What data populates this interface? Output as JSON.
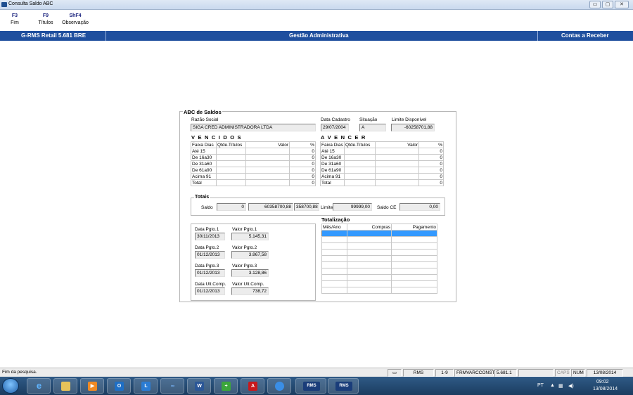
{
  "window": {
    "title": "Consulta Saldo ABC",
    "controls": [
      "▭",
      "▢",
      "✕"
    ]
  },
  "fkeys": [
    {
      "key": "F3",
      "label": "Fim"
    },
    {
      "key": "F9",
      "label": "Títulos"
    },
    {
      "key": "ShF4",
      "label": "Observação"
    }
  ],
  "bar": {
    "left": "G-RMS Retail 5.681 BRE",
    "center": "Gestão Administrativa",
    "right": "Contas a Receber"
  },
  "abc": {
    "title": "ABC de Saldos",
    "razao_label": "Razão Social",
    "razao": "SIGA CRED ADMINISTRADORA LTDA",
    "data_cad_label": "Data Cadastro",
    "data_cad": "29/07/2004",
    "situacao_label": "Situação",
    "situacao": "A",
    "limite_disp_label": "Limite Disponível",
    "limite_disp": "-60258701,88",
    "vencidos_title": "V E N C I D O S",
    "avencer_title": "A  V E N C E R",
    "cols": [
      "Faixa Dias",
      "Qtde.Títulos",
      "Valor",
      "%"
    ],
    "rows": [
      {
        "faixa": "Até 15",
        "pct": "0"
      },
      {
        "faixa": "De 16a30",
        "pct": "0"
      },
      {
        "faixa": "De 31a60",
        "pct": "0"
      },
      {
        "faixa": "De 61a90",
        "pct": "0"
      },
      {
        "faixa": "Acima 91",
        "pct": "0"
      },
      {
        "faixa": "Total",
        "pct": "0"
      }
    ],
    "totais": {
      "title": "Totais",
      "saldo_label": "Saldo",
      "saldo1": "0",
      "saldo2": "60358700,88",
      "saldo3": "358700,88",
      "limite_label": "Limite",
      "limite": "99999,00",
      "saldo_ce_label": "Saldo CE",
      "saldo_ce": "0,00"
    },
    "pgtos": [
      {
        "data_label": "Data Pgto.1",
        "data": "30/11/2013",
        "valor_label": "Valor Pgto.1",
        "valor": "5.145,31"
      },
      {
        "data_label": "Data Pgto.2",
        "data": "01/12/2013",
        "valor_label": "Valor Pgto.2",
        "valor": "3.867,58"
      },
      {
        "data_label": "Data Pgto.3",
        "data": "01/12/2013",
        "valor_label": "Valor Pgto.3",
        "valor": "3.128,86"
      },
      {
        "data_label": "Data Ult.Comp.",
        "data": "01/12/2013",
        "valor_label": "Valor Ult.Comp.",
        "valor": "738,72"
      }
    ],
    "totalizacao": {
      "title": "Totalização",
      "cols": [
        "Mês/Ano",
        "Compras",
        "Pagamento"
      ]
    }
  },
  "status": {
    "msg": "Fim da pesquisa.",
    "rms": "RMS",
    "pages": "1-9",
    "prog": "FRMVARCCONST",
    "ver": "5.681.1",
    "caps": "CAPS",
    "num": "NUM",
    "date": "13/08/2014"
  },
  "taskbar": {
    "icons": [
      "ie-icon",
      "folder-icon",
      "media-icon",
      "outlook-icon",
      "lync-icon",
      "app-icon",
      "word-icon",
      "install-icon",
      "pdf-icon",
      "globe-icon",
      "rms-icon",
      "rms-icon"
    ],
    "rms1": "RMS",
    "rms2": "RMS",
    "lang": "PT",
    "time": "09:02",
    "date": "13/08/2014"
  },
  "colors": {
    "accent": "#1f4f9e",
    "selection": "#3399ff"
  }
}
